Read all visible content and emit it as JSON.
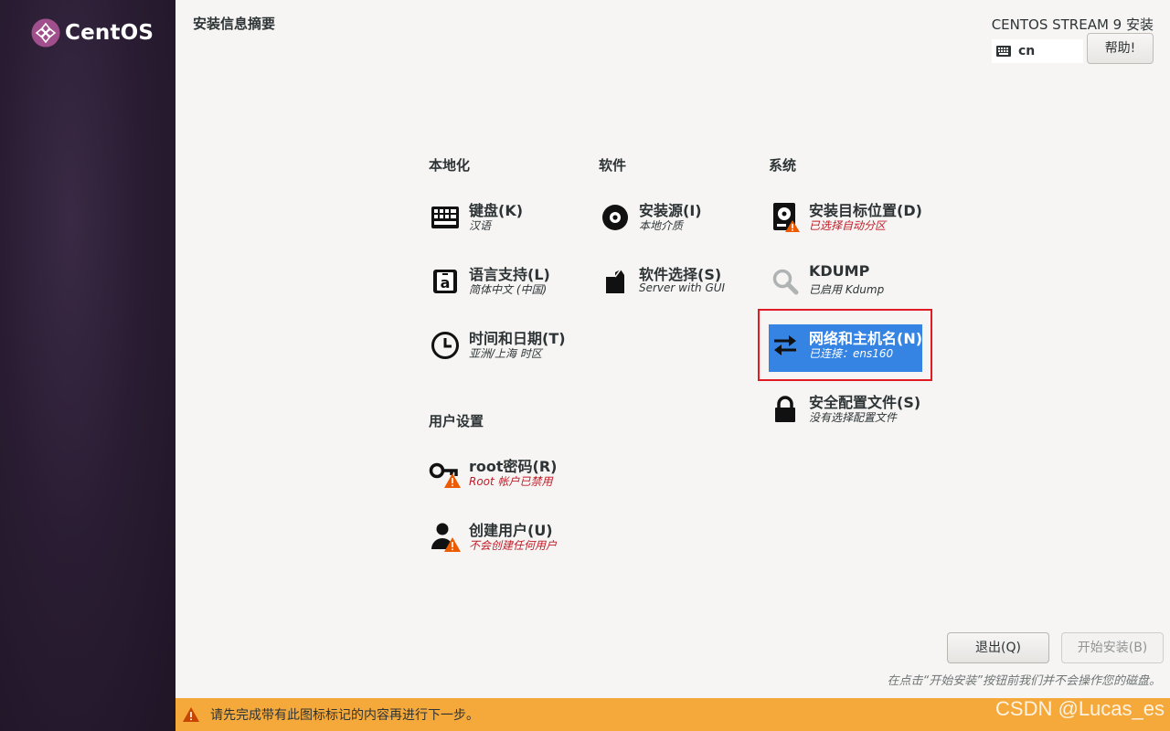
{
  "brand": {
    "logo_text": "CentOS"
  },
  "header": {
    "page_title": "安装信息摘要",
    "product_title": "CENTOS STREAM 9 安装",
    "keyboard_layout": "cn",
    "help_label": "帮助!"
  },
  "sections": {
    "localization": {
      "heading": "本地化",
      "keyboard": {
        "title": "键盘(K)",
        "status": "汉语",
        "icon": "keyboard-icon"
      },
      "language": {
        "title": "语言支持(L)",
        "status": "简体中文 (中国)",
        "icon": "language-icon"
      },
      "time": {
        "title": "时间和日期(T)",
        "status": "亚洲/上海 时区",
        "icon": "clock-icon"
      }
    },
    "software": {
      "heading": "软件",
      "source": {
        "title": "安装源(I)",
        "status": "本地介质",
        "icon": "disc-icon"
      },
      "selection": {
        "title": "软件选择(S)",
        "status": "Server with GUI",
        "icon": "package-icon"
      }
    },
    "system": {
      "heading": "系统",
      "destination": {
        "title": "安装目标位置(D)",
        "status": "已选择自动分区",
        "icon": "harddisk-warning-icon"
      },
      "kdump": {
        "title": "KDUMP",
        "status": "已启用 Kdump",
        "icon": "magnifier-icon"
      },
      "network": {
        "title": "网络和主机名(N)",
        "status": "已连接：ens160",
        "icon": "network-arrows-icon"
      },
      "security": {
        "title": "安全配置文件(S)",
        "status": "没有选择配置文件",
        "icon": "lock-icon"
      }
    },
    "user": {
      "heading": "用户设置",
      "root": {
        "title": "root密码(R)",
        "status": "Root 帐户已禁用",
        "icon": "key-warning-icon"
      },
      "create_user": {
        "title": "创建用户(U)",
        "status": "不会创建任何用户",
        "icon": "user-warning-icon"
      }
    }
  },
  "footer": {
    "quit_label": "退出(Q)",
    "begin_label": "开始安装(B)",
    "hint": "在点击“开始安装”按钮前我们并不会操作您的磁盘。",
    "warning": "请先完成带有此图标标记的内容再进行下一步。",
    "watermark": "CSDN @Lucas_es"
  },
  "colors": {
    "sidebar": "#2a1d33",
    "selected": "#3584e4",
    "warning_bar": "#f5a93b",
    "warning_text": "#c01c28",
    "highlight_box": "#e01b24"
  }
}
